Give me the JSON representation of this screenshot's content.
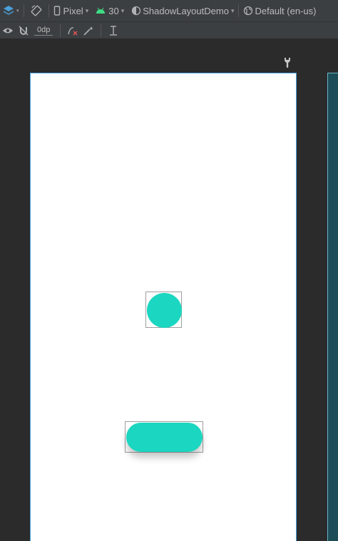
{
  "toolbar": {
    "device_label": "Pixel",
    "api_level": "30",
    "theme_label": "ShadowLayoutDemo",
    "locale_label": "Default (en-us)",
    "margin_value": "0dp"
  },
  "colors": {
    "toolbar_bg": "#3c3f41",
    "canvas_bg": "#2b2b2b",
    "accent_teal": "#1bd6c0",
    "android_green": "#3ddc84",
    "blueprint_panel": "#1d4e57",
    "selection_blue": "#4aa3df"
  },
  "icons": [
    "layers-icon",
    "orientation-icon",
    "phone-icon",
    "android-icon",
    "theme-icon",
    "globe-icon",
    "eye-icon",
    "magnet-off-icon",
    "clear-constraints-icon",
    "infer-constraints-icon",
    "baseline-icon",
    "wrench-icon"
  ]
}
